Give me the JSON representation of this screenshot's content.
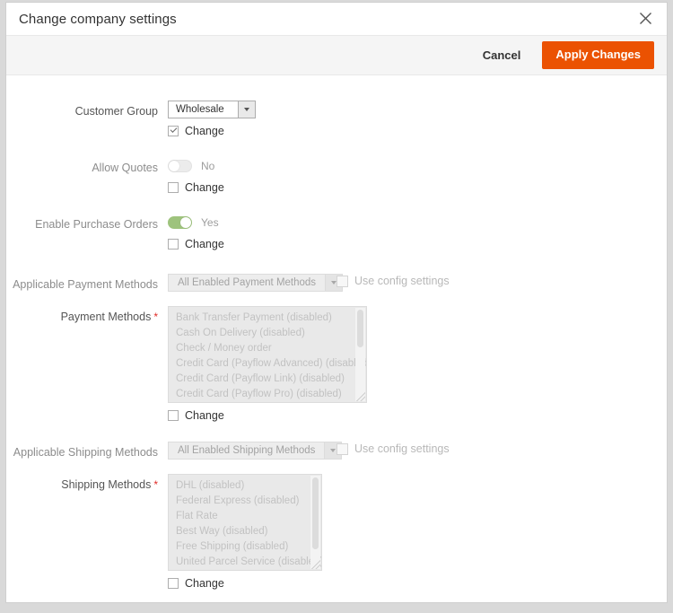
{
  "modal": {
    "title": "Change company settings",
    "close_icon": "close-icon"
  },
  "toolbar": {
    "cancel_label": "Cancel",
    "apply_label": "Apply Changes",
    "accent_color": "#eb5202"
  },
  "form": {
    "customer_group": {
      "label": "Customer Group",
      "value": "Wholesale",
      "change_label": "Change",
      "change_checked": true
    },
    "allow_quotes": {
      "label": "Allow Quotes",
      "toggle_state": "off",
      "toggle_text": "No",
      "change_label": "Change",
      "change_checked": false
    },
    "enable_purchase_orders": {
      "label": "Enable Purchase Orders",
      "toggle_state": "on",
      "toggle_text": "Yes",
      "change_label": "Change",
      "change_checked": false
    },
    "applicable_payment_methods": {
      "label": "Applicable Payment Methods",
      "value": "All Enabled Payment Methods",
      "use_config_label": "Use config settings",
      "use_config_checked": false
    },
    "payment_methods": {
      "label": "Payment Methods",
      "required": true,
      "required_marker": "*",
      "options": [
        "Bank Transfer Payment (disabled)",
        "Cash On Delivery (disabled)",
        "Check / Money order",
        "Credit Card (Payflow Advanced) (disabled)",
        "Credit Card (Payflow Link) (disabled)",
        "Credit Card (Payflow Pro) (disabled)"
      ],
      "change_label": "Change",
      "change_checked": false
    },
    "applicable_shipping_methods": {
      "label": "Applicable Shipping Methods",
      "value": "All Enabled Shipping Methods",
      "use_config_label": "Use config settings",
      "use_config_checked": false
    },
    "shipping_methods": {
      "label": "Shipping Methods",
      "required": true,
      "required_marker": "*",
      "options": [
        "DHL (disabled)",
        "Federal Express (disabled)",
        "Flat Rate",
        "Best Way (disabled)",
        "Free Shipping (disabled)",
        "United Parcel Service (disabled)"
      ],
      "change_label": "Change",
      "change_checked": false
    }
  }
}
